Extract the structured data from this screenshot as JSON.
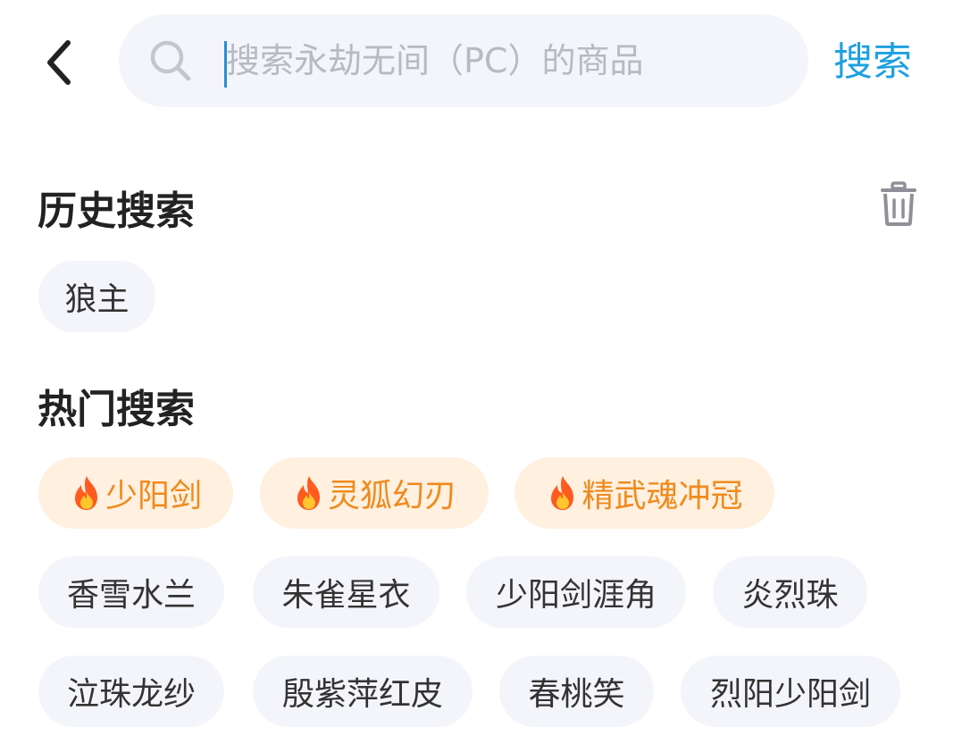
{
  "header": {
    "search_placeholder": "搜索永劫无间（PC）的商品",
    "search_button": "搜索",
    "back_icon": "chevron-left-icon",
    "search_icon": "search-icon",
    "accent_color": "#1ea0e0"
  },
  "history": {
    "title": "历史搜索",
    "delete_icon": "trash-icon",
    "items": [
      "狼主"
    ]
  },
  "hot": {
    "title": "热门搜索",
    "featured": [
      "少阳剑",
      "灵狐幻刃",
      "精武魂冲冠"
    ],
    "featured_color": "#f08a1c",
    "items": [
      "香雪水兰",
      "朱雀星衣",
      "少阳剑涯角",
      "炎烈珠",
      "泣珠龙纱",
      "殷紫萍红皮",
      "春桃笑",
      "烈阳少阳剑"
    ]
  }
}
